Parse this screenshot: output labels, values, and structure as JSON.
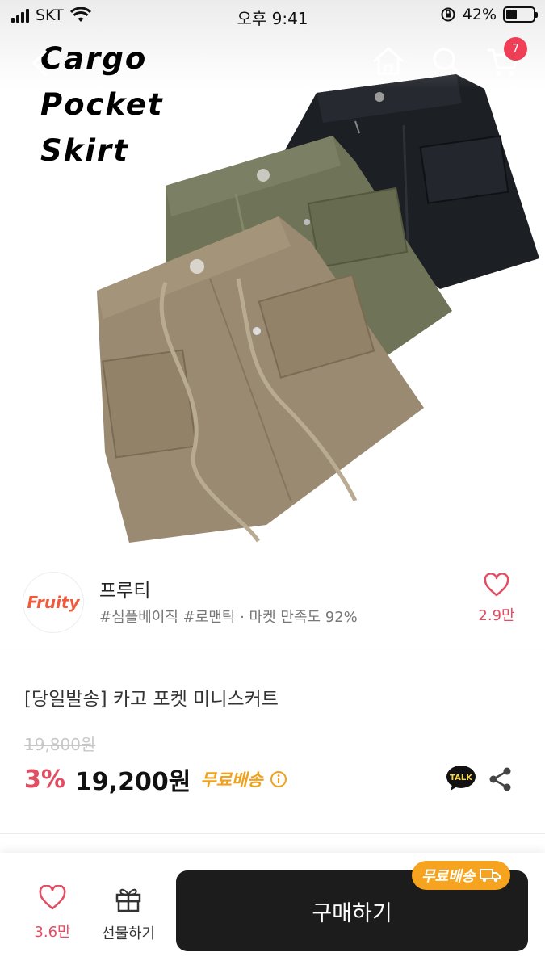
{
  "status_bar": {
    "carrier": "SKT",
    "time": "오후 9:41",
    "battery": "42%"
  },
  "hero": {
    "overlay_lines": [
      "Cargo",
      "Pocket",
      "Skirt"
    ],
    "skirt_colors": [
      "#1c1f24",
      "#6f7358",
      "#9a8a72"
    ]
  },
  "nav": {
    "cart_count": "7",
    "icons": [
      "back-arrow-icon",
      "home-icon",
      "search-icon",
      "cart-icon"
    ]
  },
  "seller": {
    "logo_text": "Fruity",
    "name": "프루티",
    "meta": "#심플베이직 #로맨틱 · 마켓 만족도 92%",
    "like_count": "2.9만"
  },
  "product": {
    "title": "[당일발송] 카고 포켓 미니스커트",
    "original_price": "19,800원",
    "discount": "3%",
    "price": "19,200원",
    "shipping": "무료배송",
    "talk_label": "TALK"
  },
  "bottom_bar": {
    "like_count": "3.6만",
    "gift_label": "선물하기",
    "buy_label": "구매하기",
    "buy_badge": "무료배송"
  },
  "colors": {
    "accent_red": "#e24d62",
    "shipping_orange": "#f0a21c",
    "buy_button": "#1c1c1c",
    "badge_red": "#ef3e55"
  }
}
